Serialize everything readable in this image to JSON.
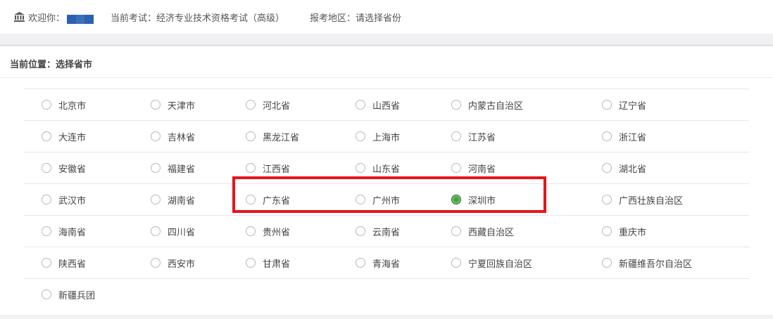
{
  "header": {
    "welcome_label": "欢迎你：",
    "current_exam": "当前考试：经济专业技术资格考试（高级）",
    "exam_region": "报考地区：请选择省份"
  },
  "breadcrumb": {
    "label": "当前位置：选择省市"
  },
  "selected": "深圳市",
  "colors": {
    "checked": "#3aaa35",
    "highlight_box": "#e8141a"
  },
  "rows": [
    [
      "北京市",
      "天津市",
      "河北省",
      "山西省",
      "内蒙古自治区",
      "辽宁省"
    ],
    [
      "大连市",
      "吉林省",
      "黑龙江省",
      "上海市",
      "江苏省",
      "浙江省"
    ],
    [
      "安徽省",
      "福建省",
      "江西省",
      "山东省",
      "河南省",
      "湖北省"
    ],
    [
      "武汉市",
      "湖南省",
      "广东省",
      "广州市",
      "深圳市",
      "广西壮族自治区"
    ],
    [
      "海南省",
      "四川省",
      "贵州省",
      "云南省",
      "西藏自治区",
      "重庆市"
    ],
    [
      "陕西省",
      "西安市",
      "甘肃省",
      "青海省",
      "宁夏回族自治区",
      "新疆维吾尔自治区"
    ],
    [
      "新疆兵团"
    ]
  ]
}
